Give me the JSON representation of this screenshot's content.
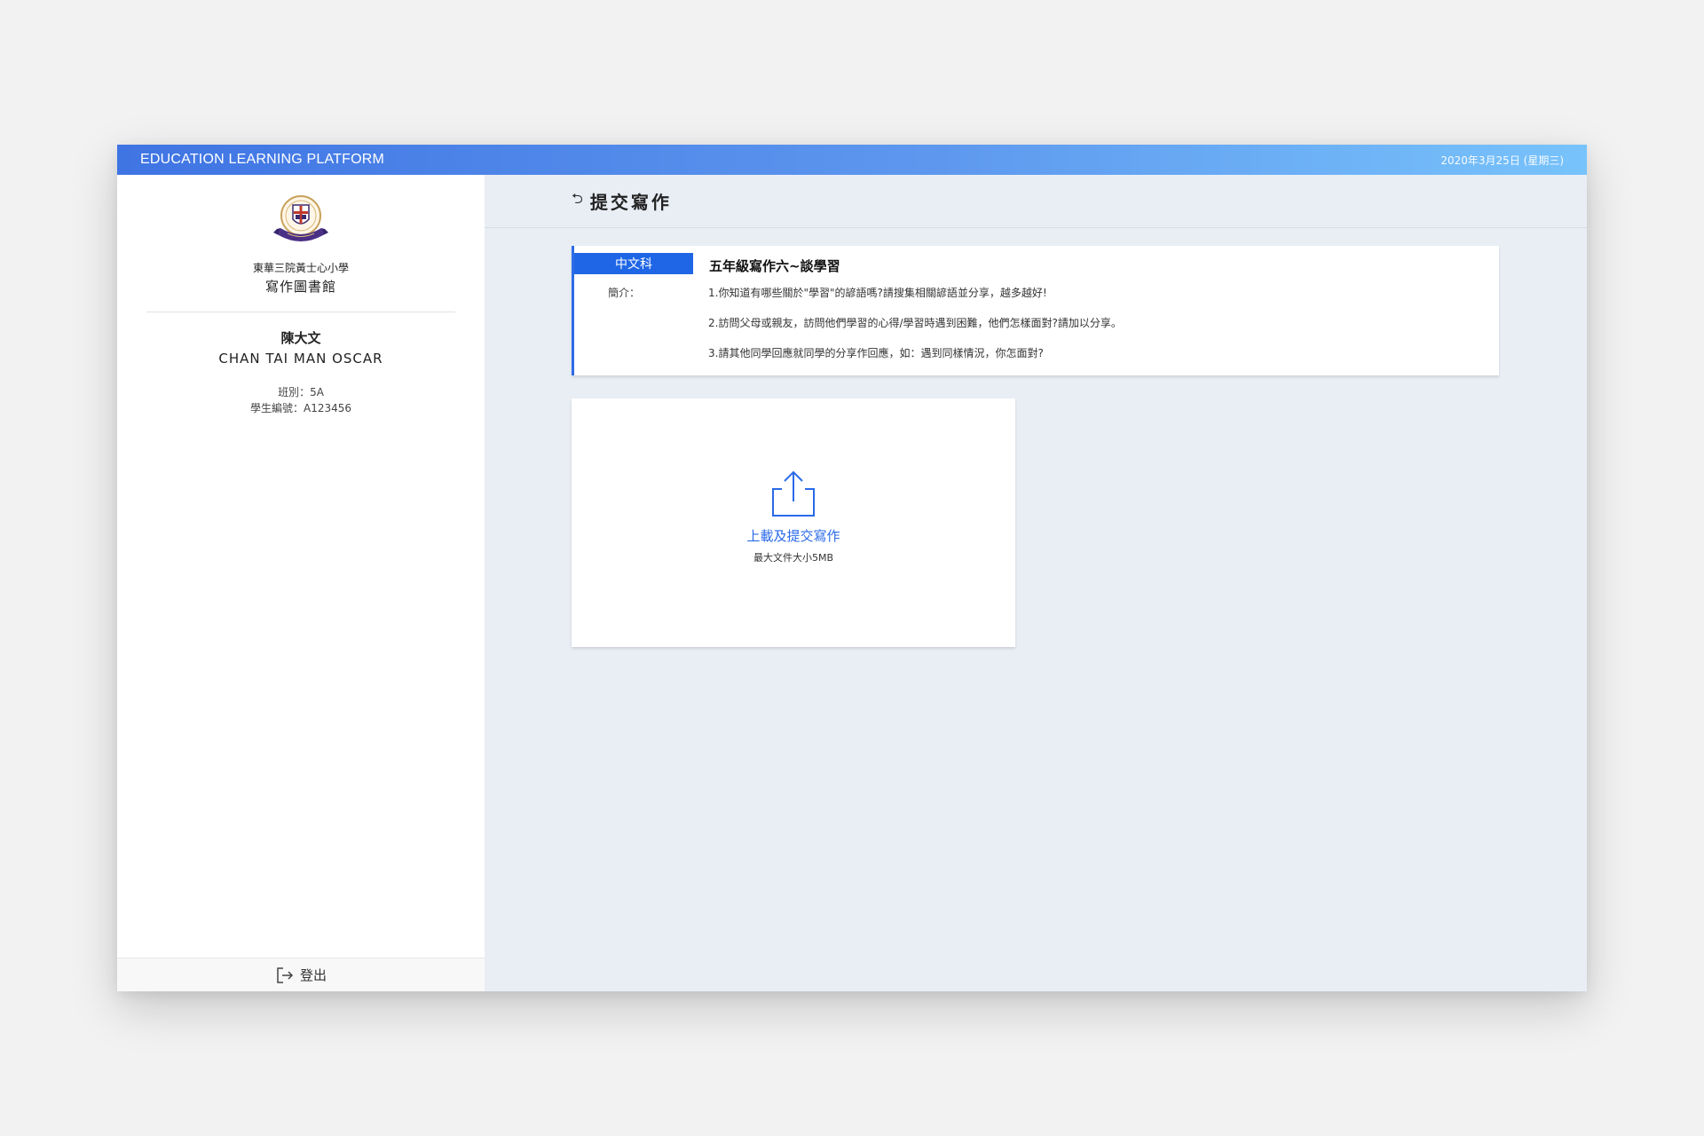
{
  "topbar": {
    "brand": "EDUCATION LEARNING PLATFORM",
    "date": "2020年3月25日 (星期三)"
  },
  "sidebar": {
    "school_name": "東華三院黃士心小學",
    "library_name": "寫作圖書館",
    "student_name_cn": "陳大文",
    "student_name_en": "CHAN TAI MAN OSCAR",
    "class_label": "班別：5A",
    "student_id_label": "學生編號：A123456",
    "logout_label": "登出"
  },
  "page": {
    "title": "提交寫作"
  },
  "assignment": {
    "subject": "中文科",
    "title": "五年級寫作六~談學習",
    "intro_label": "簡介：",
    "intro_items": [
      "1.你知道有哪些關於\"學習\"的諺語嗎?請搜集相關諺語並分享，越多越好!",
      "2.訪問父母或親友，訪問他們學習的心得/學習時遇到困難，他們怎樣面對?請加以分享。",
      "3.請其他同學回應就同學的分享作回應，如：遇到同樣情況，你怎面對?"
    ]
  },
  "upload": {
    "label": "上載及提交寫作",
    "hint": "最大文件大小5MB"
  },
  "colors": {
    "accent": "#1f66e6",
    "topbar_start": "#3f74e3",
    "topbar_end": "#78c3fb",
    "main_bg": "#e9eef5"
  },
  "icons": {
    "logo": "school-crest-icon",
    "back": "back-arrow-icon",
    "upload": "upload-icon",
    "logout": "logout-icon"
  }
}
